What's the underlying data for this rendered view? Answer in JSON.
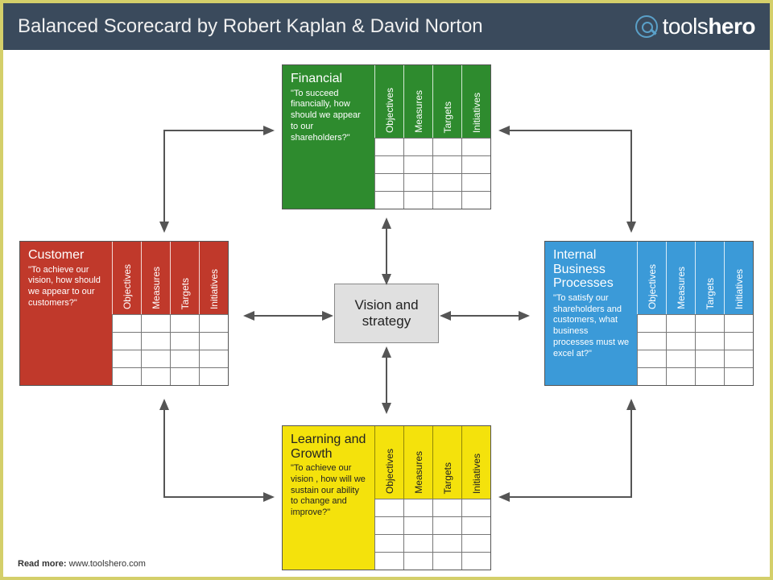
{
  "header": {
    "title": "Balanced Scorecard by Robert Kaplan & David Norton",
    "logo_prefix": "tools",
    "logo_suffix": "hero"
  },
  "center": {
    "label": "Vision and strategy"
  },
  "columns": [
    "Objectives",
    "Measures",
    "Targets",
    "Initiatives"
  ],
  "quadrants": {
    "financial": {
      "title": "Financial",
      "question": "\"To succeed financially, how should we appear to our shareholders?\""
    },
    "customer": {
      "title": "Customer",
      "question": "\"To achieve our vision, how should we appear to our customers?\""
    },
    "internal": {
      "title": "Internal Business Processes",
      "question": "\"To satisfy our shareholders and customers, what business processes must we excel at?\""
    },
    "learning": {
      "title": "Learning and Growth",
      "question": "\"To achieve our vision , how will we sustain our ability to change and improve?\""
    }
  },
  "footer": {
    "readmore_label": "Read more:",
    "readmore_url": "www.toolshero.com"
  }
}
